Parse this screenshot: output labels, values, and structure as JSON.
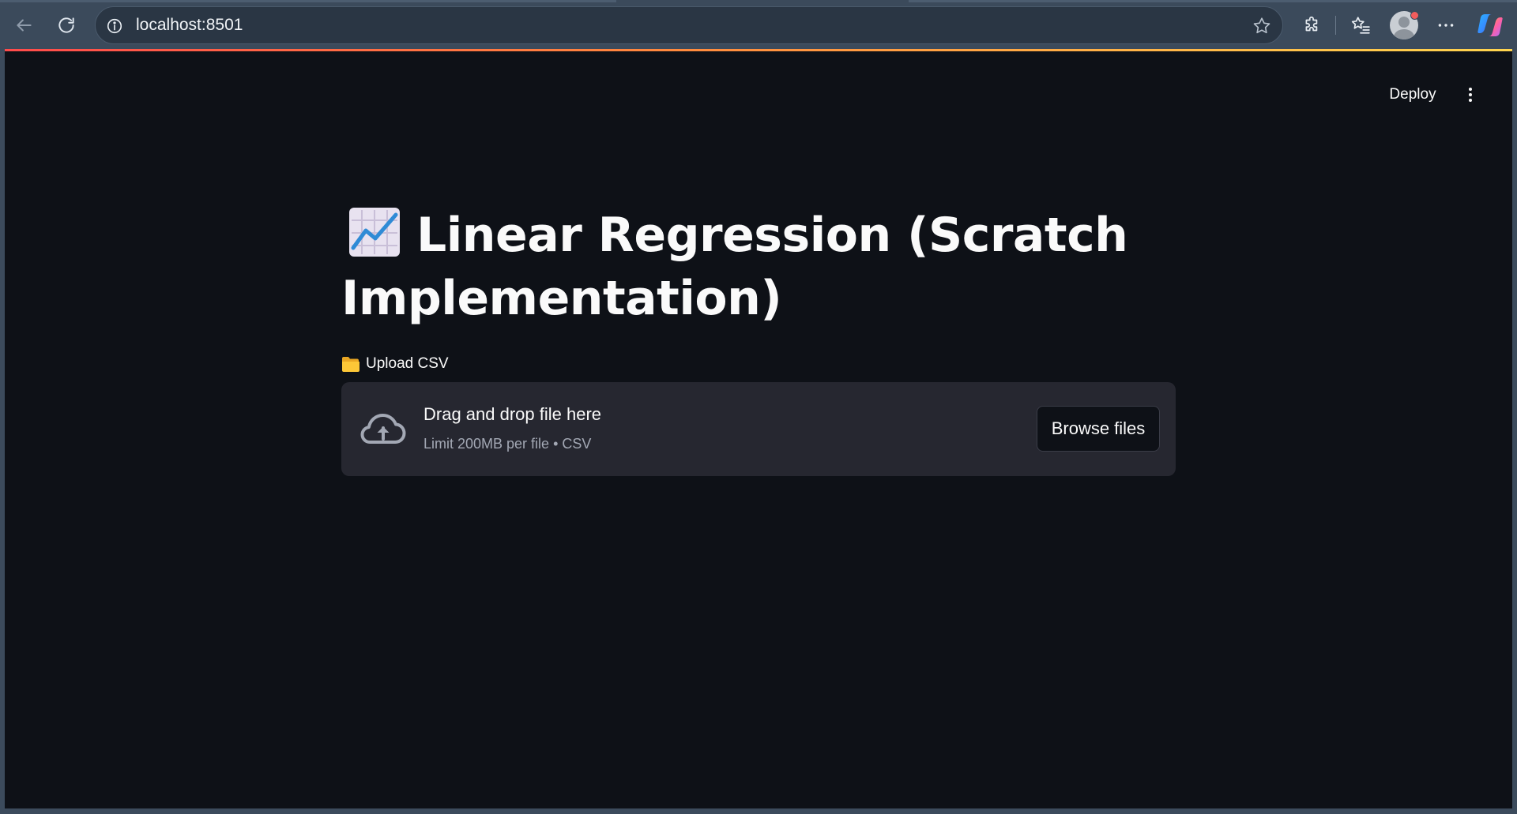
{
  "browser": {
    "url": "localhost:8501",
    "back_icon": "arrow-left-icon",
    "reload_icon": "reload-icon",
    "site_info_icon": "info-circle-icon",
    "bookmark_icon": "star-outline-icon",
    "extensions_icon": "puzzle-icon",
    "favorites_icon": "favorites-list-icon",
    "profile_icon": "avatar",
    "more_icon": "ellipsis-icon",
    "copilot_icon": "copilot-icon"
  },
  "header": {
    "deploy_label": "Deploy",
    "menu_icon": "vertical-dots-icon"
  },
  "main": {
    "title_emoji": "chart-increasing-icon",
    "title": "Linear Regression (Scratch Implementation)",
    "uploader": {
      "label_emoji": "folder-icon",
      "label": "Upload CSV",
      "dropzone_title": "Drag and drop file here",
      "dropzone_limit": "Limit 200MB per file • CSV",
      "browse_label": "Browse files"
    }
  },
  "colors": {
    "app_background": "#0e1117",
    "dropzone_background": "#262730",
    "text": "#fafafa",
    "muted_text": "#a3a8b4",
    "chrome_background": "#3b4a5b",
    "decoration_gradient": [
      "#ff4b4b",
      "#ffd54f"
    ]
  }
}
